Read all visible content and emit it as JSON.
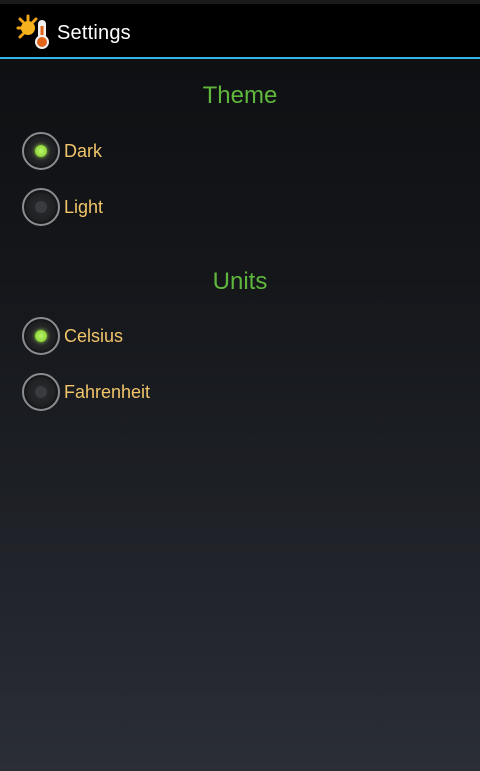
{
  "action_bar": {
    "title": "Settings",
    "icon": "sun-thermometer-icon"
  },
  "sections": [
    {
      "header": "Theme",
      "options": [
        {
          "label": "Dark",
          "checked": true
        },
        {
          "label": "Light",
          "checked": false
        }
      ]
    },
    {
      "header": "Units",
      "options": [
        {
          "label": "Celsius",
          "checked": true
        },
        {
          "label": "Fahrenheit",
          "checked": false
        }
      ]
    }
  ],
  "colors": {
    "accent_divider": "#33b5e5",
    "section_header": "#5fb63d",
    "option_label": "#f1c56a",
    "radio_checked": "#8fd63a"
  }
}
